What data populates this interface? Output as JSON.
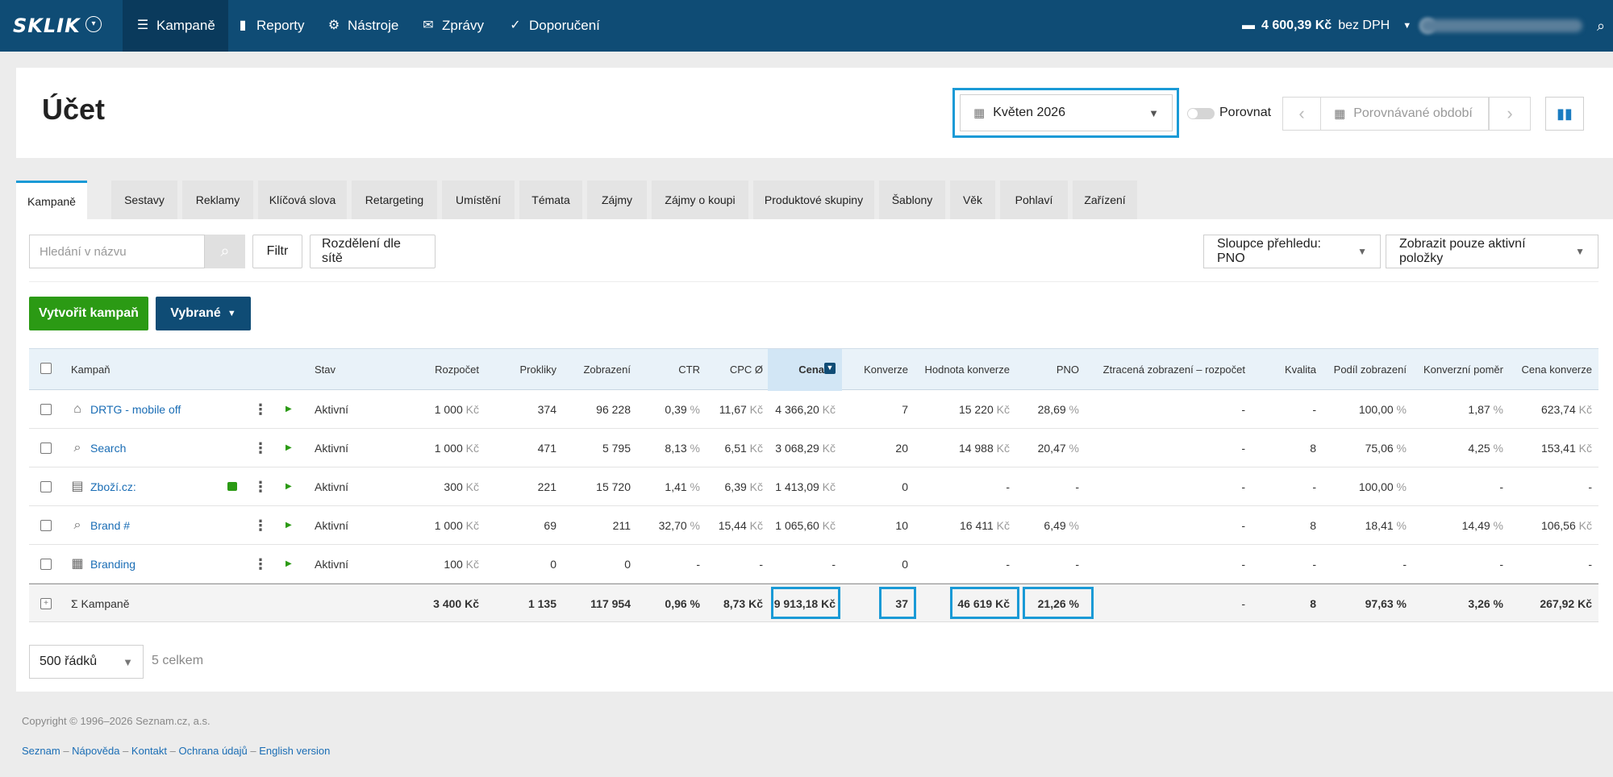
{
  "topbar": {
    "logo": "SKLIK",
    "nav": [
      {
        "label": "Kampaně",
        "icon": "menu-icon",
        "glyph": "☰"
      },
      {
        "label": "Reporty",
        "icon": "bar-chart-icon",
        "glyph": "▮"
      },
      {
        "label": "Nástroje",
        "icon": "gear-icon",
        "glyph": "⚙"
      },
      {
        "label": "Zprávy",
        "icon": "envelope-icon",
        "glyph": "✉"
      },
      {
        "label": "Doporučení",
        "icon": "bulb-icon",
        "glyph": "✓"
      }
    ],
    "balance_amount": "4 600,39 Kč",
    "balance_suffix": "bez DPH"
  },
  "header": {
    "title": "Účet",
    "date_value": "Květen 2026",
    "compare_label": "Porovnat",
    "compare_placeholder": "Porovnávané období"
  },
  "tabs": [
    "Kampaně",
    "Sestavy",
    "Reklamy",
    "Klíčová slova",
    "Retargeting",
    "Umístění",
    "Témata",
    "Zájmy",
    "Zájmy o koupi",
    "Produktové skupiny",
    "Šablony",
    "Věk",
    "Pohlaví",
    "Zařízení"
  ],
  "toolbar": {
    "search_placeholder": "Hledání v názvu",
    "filter_label": "Filtr",
    "split_label": "Rozdělení dle sítě",
    "columns_label": "Sloupce přehledu: PNO",
    "active_only_label": "Zobrazit pouze aktivní položky",
    "create_label": "Vytvořit kampaň",
    "selected_label": "Vybrané"
  },
  "table": {
    "headers": [
      "Kampaň",
      "Stav",
      "Rozpočet",
      "Prokliky",
      "Zobrazení",
      "CTR",
      "CPC Ø",
      "Cena",
      "Konverze",
      "Hodnota konverze",
      "PNO",
      "Ztracená zobrazení – rozpočet",
      "Kvalita",
      "Podíl zobrazení",
      "Konverzní poměr",
      "Cena konverze"
    ],
    "rows": [
      {
        "name": "DRTG - mobile off",
        "icon": "retargeting-icon",
        "status": "Aktivní",
        "budget": "1 000",
        "clicks": "374",
        "impressions": "96 228",
        "ctr": "0,39",
        "cpc": "11,67",
        "cost": "4 366,20",
        "conversions": "7",
        "conv_value": "15 220",
        "pno": "28,69",
        "lost": "-",
        "quality": "-",
        "share": "100,00",
        "conv_rate": "1,87",
        "conv_cost": "623,74"
      },
      {
        "name": "Search",
        "icon": "search-icon",
        "status": "Aktivní",
        "budget": "1 000",
        "clicks": "471",
        "impressions": "5 795",
        "ctr": "8,13",
        "cpc": "6,51",
        "cost": "3 068,29",
        "conversions": "20",
        "conv_value": "14 988",
        "pno": "20,47",
        "lost": "-",
        "quality": "8",
        "share": "75,06",
        "conv_rate": "4,25",
        "conv_cost": "153,41"
      },
      {
        "name": "Zboží.cz:",
        "icon": "shop-icon",
        "status": "Aktivní",
        "budget": "300",
        "clicks": "221",
        "impressions": "15 720",
        "ctr": "1,41",
        "cpc": "6,39",
        "cost": "1 413,09",
        "conversions": "0",
        "conv_value": "-",
        "pno": "-",
        "lost": "-",
        "quality": "-",
        "share": "100,00",
        "conv_rate": "-",
        "conv_cost": "-"
      },
      {
        "name": "Brand #",
        "icon": "search-icon",
        "status": "Aktivní",
        "budget": "1 000",
        "clicks": "69",
        "impressions": "211",
        "ctr": "32,70",
        "cpc": "15,44",
        "cost": "1 065,60",
        "conversions": "10",
        "conv_value": "16 411",
        "pno": "6,49",
        "lost": "-",
        "quality": "8",
        "share": "18,41",
        "conv_rate": "14,49",
        "conv_cost": "106,56"
      },
      {
        "name": "Branding",
        "icon": "content-icon",
        "status": "Aktivní",
        "budget": "100",
        "clicks": "0",
        "impressions": "0",
        "ctr": "-",
        "cpc": "-",
        "cost": "-",
        "conversions": "0",
        "conv_value": "-",
        "pno": "-",
        "lost": "-",
        "quality": "-",
        "share": "-",
        "conv_rate": "-",
        "conv_cost": "-"
      }
    ],
    "summary": {
      "label": "Σ Kampaně",
      "budget": "3 400 Kč",
      "clicks": "1 135",
      "impressions": "117 954",
      "ctr": "0,96 %",
      "cpc": "8,73 Kč",
      "cost": "9 913,18 Kč",
      "conversions": "37",
      "conv_value": "46 619 Kč",
      "pno": "21,26 %",
      "lost": "-",
      "quality": "8",
      "share": "97,63 %",
      "conv_rate": "3,26 %",
      "conv_cost": "267,92 Kč"
    },
    "unit_kc": "Kč",
    "unit_pct": "%"
  },
  "pagination": {
    "rows_label": "500 řádků",
    "total_label": "5 celkem"
  },
  "footer": {
    "copyright": "Copyright © 1996–2026 Seznam.cz, a.s.",
    "links": [
      "Seznam",
      "Nápověda",
      "Kontakt",
      "Ochrana údajů",
      "English version"
    ]
  },
  "colors": {
    "topbar": "#0f4c75",
    "accent": "#1a9ad6",
    "green": "#2b9a14",
    "link": "#1a6db5"
  }
}
